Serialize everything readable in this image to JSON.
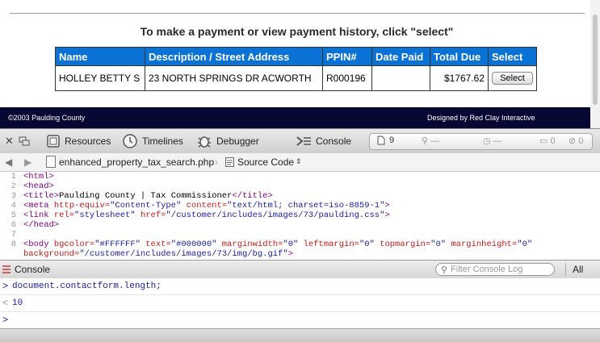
{
  "page": {
    "instructions": "To make a payment or view payment history, click \"select\"",
    "table": {
      "headers": [
        "Name",
        "Description / Street Address",
        "PPIN#",
        "Date Paid",
        "Total Due",
        "Select"
      ],
      "row": {
        "name": "HOLLEY BETTY S",
        "address": "23 NORTH SPRINGS DR ACWORTH",
        "ppin": "R000196",
        "date_paid": "",
        "total_due": "$1767.62",
        "select_label": "Select"
      }
    },
    "footer": {
      "left": "©2003 Paulding County",
      "right": "Designed by Red Clay Interactive"
    }
  },
  "inspector": {
    "tabs": [
      {
        "label": "Resources",
        "icon": "resources-icon"
      },
      {
        "label": "Timelines",
        "icon": "clock-icon"
      },
      {
        "label": "Debugger",
        "icon": "bug-icon"
      },
      {
        "label": "Console",
        "icon": "console-icon"
      }
    ],
    "counters": {
      "documents": "9",
      "errors": "0",
      "warnings": "0",
      "logs": "0"
    },
    "breadcrumb": {
      "file": "enhanced_property_tax_search.php",
      "view": "Source Code"
    },
    "source_lines": [
      {
        "n": "1",
        "parts": [
          [
            "tag",
            "<html>"
          ]
        ]
      },
      {
        "n": "2",
        "parts": [
          [
            "tag",
            "<head>"
          ]
        ]
      },
      {
        "n": "3",
        "parts": [
          [
            "tag",
            "<title>"
          ],
          [
            "txt",
            "Paulding County | Tax Commissioner"
          ],
          [
            "tag",
            "</title>"
          ]
        ]
      },
      {
        "n": "4",
        "parts": [
          [
            "tag",
            "<meta "
          ],
          [
            "attr",
            "http-equiv="
          ],
          [
            "val",
            "\"Content-Type\""
          ],
          [
            "attr",
            " content="
          ],
          [
            "val",
            "\"text/html; charset=iso-8859-1\""
          ],
          [
            "tag",
            ">"
          ]
        ]
      },
      {
        "n": "5",
        "parts": [
          [
            "tag",
            "<link "
          ],
          [
            "attr",
            "rel="
          ],
          [
            "val",
            "\"stylesheet\""
          ],
          [
            "attr",
            " href="
          ],
          [
            "val",
            "\"/customer/includes/images/73/paulding.css\""
          ],
          [
            "tag",
            ">"
          ]
        ]
      },
      {
        "n": "6",
        "parts": [
          [
            "tag",
            "</head>"
          ]
        ]
      },
      {
        "n": "7",
        "parts": [
          [
            "txt",
            ""
          ]
        ]
      },
      {
        "n": "8",
        "parts": [
          [
            "tag",
            "<body "
          ],
          [
            "attr",
            "bgcolor="
          ],
          [
            "val",
            "\"#FFFFFF\""
          ],
          [
            "attr",
            " text="
          ],
          [
            "val",
            "\"#000000\""
          ],
          [
            "attr",
            " marginwidth="
          ],
          [
            "val",
            "\"0\""
          ],
          [
            "attr",
            " leftmargin="
          ],
          [
            "val",
            "\"0\""
          ],
          [
            "attr",
            " topmargin="
          ],
          [
            "val",
            "\"0\""
          ],
          [
            "attr",
            " marginheight="
          ],
          [
            "val",
            "\"0\""
          ]
        ]
      },
      {
        "n": "",
        "parts": [
          [
            "attr",
            "background="
          ],
          [
            "val",
            "\"/customer/includes/images/73/img/bg.gif\""
          ],
          [
            "tag",
            ">"
          ]
        ]
      }
    ],
    "console": {
      "title": "Console",
      "filter_placeholder": "Filter Console Log",
      "all_label": "All",
      "entries": [
        {
          "prompt": ">",
          "text": "document.contactform.length;"
        },
        {
          "prompt": "<",
          "text": "10"
        },
        {
          "prompt": ">",
          "text": ""
        }
      ]
    }
  },
  "colors": {
    "table_header": "#0a72d4",
    "footer_bg": "#070733"
  }
}
